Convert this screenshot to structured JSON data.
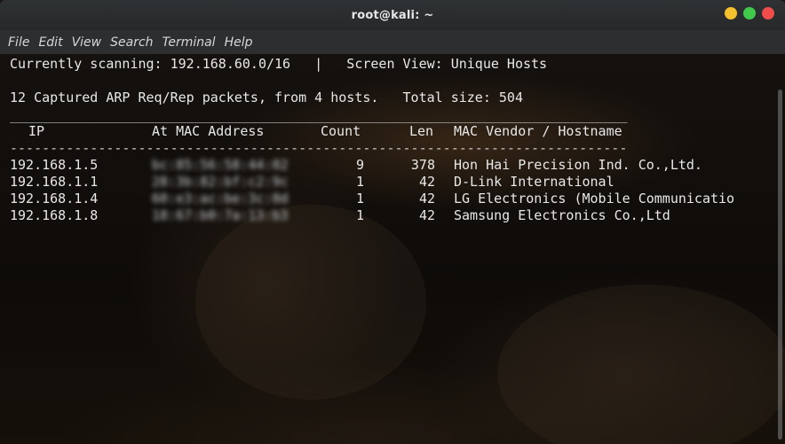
{
  "window": {
    "title": "root@kali: ~",
    "controls": [
      {
        "name": "minimize",
        "color": "#f5c12e"
      },
      {
        "name": "maximize",
        "color": "#41c94c"
      },
      {
        "name": "close",
        "color": "#f14c4c"
      }
    ]
  },
  "menu": [
    "File",
    "Edit",
    "View",
    "Search",
    "Terminal",
    "Help"
  ],
  "terminal": {
    "status_line": "Currently scanning: 192.168.60.0/16   |   Screen View: Unique Hosts",
    "summary_line": "12 Captured ARP Req/Rep packets, from 4 hosts.   Total size: 504",
    "top_rule": "_____________________________________________________________________________",
    "header": {
      "ip": "IP",
      "mac": "At MAC Address",
      "count": "Count",
      "len": "Len",
      "vendor": "MAC Vendor / Hostname"
    },
    "dash_rule": "-----------------------------------------------------------------------------",
    "rows": [
      {
        "ip": "192.168.1.5",
        "mac": "bc:85:56:58:44:02",
        "count": "9",
        "len": "378",
        "vendor": "Hon Hai Precision Ind. Co.,Ltd."
      },
      {
        "ip": "192.168.1.1",
        "mac": "28:3b:82:bf:c2:9c",
        "count": "1",
        "len": "42",
        "vendor": "D-Link International"
      },
      {
        "ip": "192.168.1.4",
        "mac": "60:e3:ac:be:3c:0d",
        "count": "1",
        "len": "42",
        "vendor": "LG Electronics (Mobile Communicatio"
      },
      {
        "ip": "192.168.1.8",
        "mac": "18:67:b0:7a:13:b3",
        "count": "1",
        "len": "42",
        "vendor": "Samsung Electronics Co.,Ltd"
      }
    ]
  }
}
